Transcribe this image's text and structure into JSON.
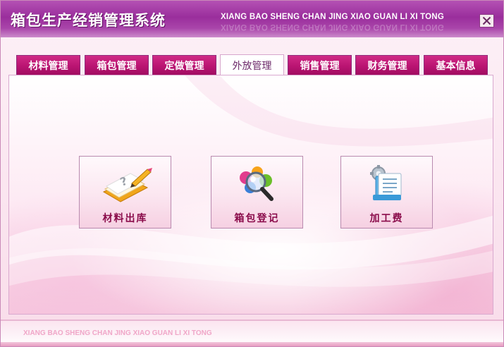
{
  "window": {
    "title": "箱包生产经销管理系统",
    "title_en": "XIANG BAO SHENG CHAN JING XIAO GUAN LI XI TONG",
    "footer_text": "XIANG BAO SHENG CHAN JING XIAO GUAN LI XI TONG",
    "close_icon": "close-icon"
  },
  "tabs": [
    {
      "label": "材料管理",
      "active": false
    },
    {
      "label": "箱包管理",
      "active": false
    },
    {
      "label": "定做管理",
      "active": false
    },
    {
      "label": "外放管理",
      "active": true
    },
    {
      "label": "销售管理",
      "active": false
    },
    {
      "label": "财务管理",
      "active": false
    },
    {
      "label": "基本信息",
      "active": false
    }
  ],
  "functions": [
    {
      "label": "材料出库",
      "icon": "notepad-pencil-icon"
    },
    {
      "label": "箱包登记",
      "icon": "magnifier-search-icon"
    },
    {
      "label": "加工费",
      "icon": "document-gear-icon"
    }
  ],
  "colors": {
    "title_bar": "#9a2e9c",
    "tab": "#ba1472",
    "active_tab_text": "#6d2a6a",
    "button_label": "#8a0b4a"
  }
}
